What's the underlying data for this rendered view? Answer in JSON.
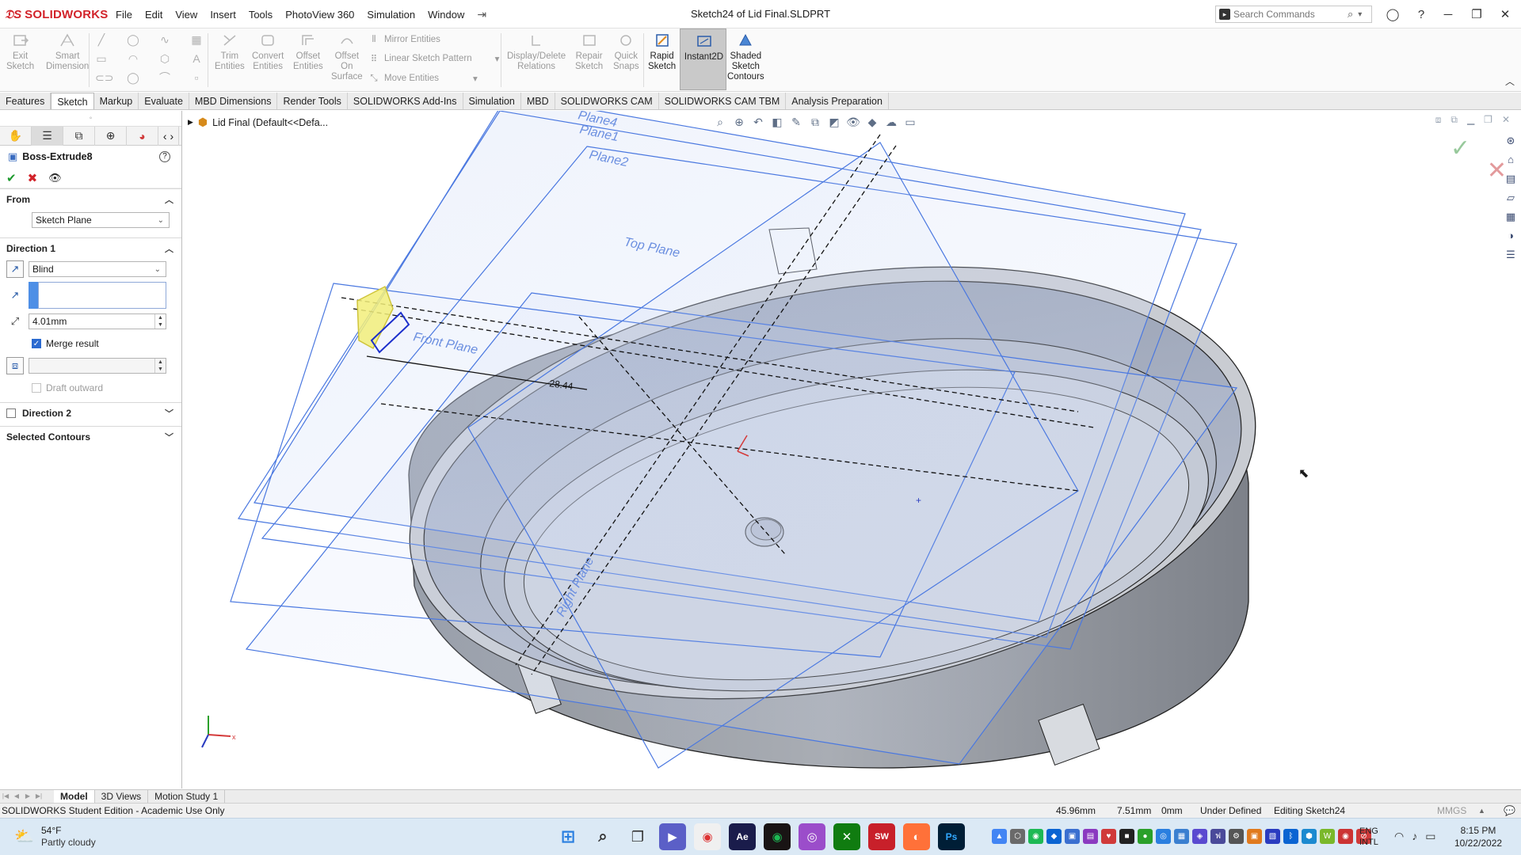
{
  "app": {
    "brand": "SOLIDWORKS",
    "document_title": "Sketch24 of Lid Final.SLDPRT",
    "menu": [
      "File",
      "Edit",
      "View",
      "Insert",
      "Tools",
      "PhotoView 360",
      "Simulation",
      "Window"
    ],
    "search_placeholder": "Search Commands"
  },
  "command_manager": {
    "exit_sketch": [
      "Exit",
      "Sketch"
    ],
    "smart_dimension": [
      "Smart",
      "Dimension"
    ],
    "trim_entities": [
      "Trim",
      "Entities"
    ],
    "convert_entities": [
      "Convert",
      "Entities"
    ],
    "offset_entities": [
      "Offset",
      "Entities"
    ],
    "offset_on_surface": [
      "Offset",
      "On",
      "Surface"
    ],
    "mirror_entities": "Mirror Entities",
    "linear_sketch_pattern": "Linear Sketch Pattern",
    "move_entities": "Move Entities",
    "display_delete_relations": [
      "Display/Delete",
      "Relations"
    ],
    "repair_sketch": [
      "Repair",
      "Sketch"
    ],
    "quick_snaps": [
      "Quick",
      "Snaps"
    ],
    "rapid_sketch": [
      "Rapid",
      "Sketch"
    ],
    "instant2d": "Instant2D",
    "shaded_sketch_contours": [
      "Shaded",
      "Sketch",
      "Contours"
    ]
  },
  "tabs": [
    "Features",
    "Sketch",
    "Markup",
    "Evaluate",
    "MBD Dimensions",
    "Render Tools",
    "SOLIDWORKS Add-Ins",
    "Simulation",
    "MBD",
    "SOLIDWORKS CAM",
    "SOLIDWORKS CAM TBM",
    "Analysis Preparation"
  ],
  "active_tab": "Sketch",
  "property_manager": {
    "title": "Boss-Extrude8",
    "from_label": "From",
    "from_value": "Sketch Plane",
    "direction1_label": "Direction 1",
    "end_condition": "Blind",
    "depth": "4.01mm",
    "merge_result": "Merge result",
    "merge_checked": true,
    "draft_outward": "Draft outward",
    "direction2_label": "Direction 2",
    "selected_contours_label": "Selected Contours"
  },
  "viewport": {
    "tree_item": "Lid Final  (Default<<Defa...",
    "plane_labels": [
      "Plane4",
      "Plane1",
      "Plane2",
      "Top Plane",
      "Front Plane",
      "Right Plane"
    ],
    "dimension": "28.44"
  },
  "bottom_tabs": [
    "Model",
    "3D Views",
    "Motion Study 1"
  ],
  "status": {
    "edition": "SOLIDWORKS Student Edition - Academic Use Only",
    "x": "45.96mm",
    "y": "7.51mm",
    "z": "0mm",
    "definition": "Under Defined",
    "editing": "Editing Sketch24",
    "units": "MMGS"
  },
  "taskbar": {
    "temperature": "54°F",
    "weather": "Partly cloudy",
    "lang1": "ENG",
    "lang2": "INTL",
    "time": "8:15 PM",
    "date": "10/22/2022"
  },
  "colors": {
    "brand_red": "#d2232a",
    "plane_blue": "#4a78e0",
    "model_gray": "#9ea3ac",
    "ok_green": "#1e9a2e"
  }
}
